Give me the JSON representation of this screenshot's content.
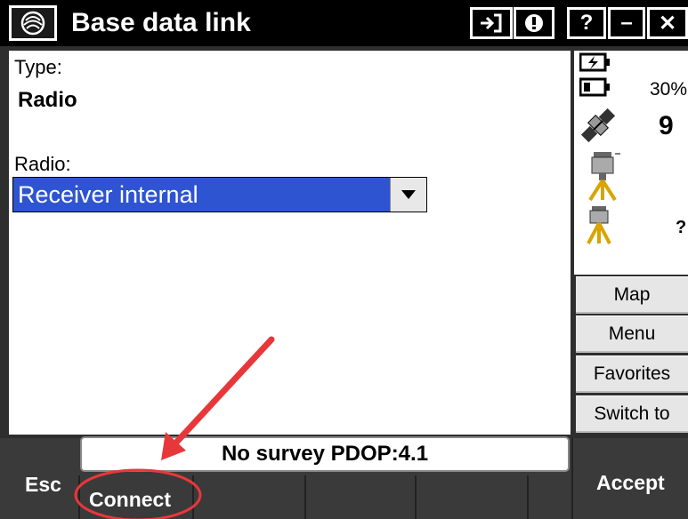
{
  "window": {
    "title": "Base data link",
    "icons": [
      "trimble-logo-icon",
      "login-icon",
      "alert-icon"
    ],
    "help_label": "?",
    "minimize_label": "–",
    "close_label": "✕"
  },
  "form": {
    "type_label": "Type:",
    "type_value": "Radio",
    "radio_label": "Radio:",
    "radio_value": "Receiver internal"
  },
  "status": {
    "battery_percent": "30%",
    "satellite_count": "9",
    "unknown_indicator": "?"
  },
  "side_buttons": {
    "map": "Map",
    "menu": "Menu",
    "favorites": "Favorites",
    "switch_to": "Switch to"
  },
  "status_bar": {
    "text": "No survey  PDOP:4.1"
  },
  "softkeys": {
    "esc": "Esc",
    "connect": "Connect",
    "accept": "Accept"
  },
  "annotation": {
    "color": "#e8373a"
  }
}
